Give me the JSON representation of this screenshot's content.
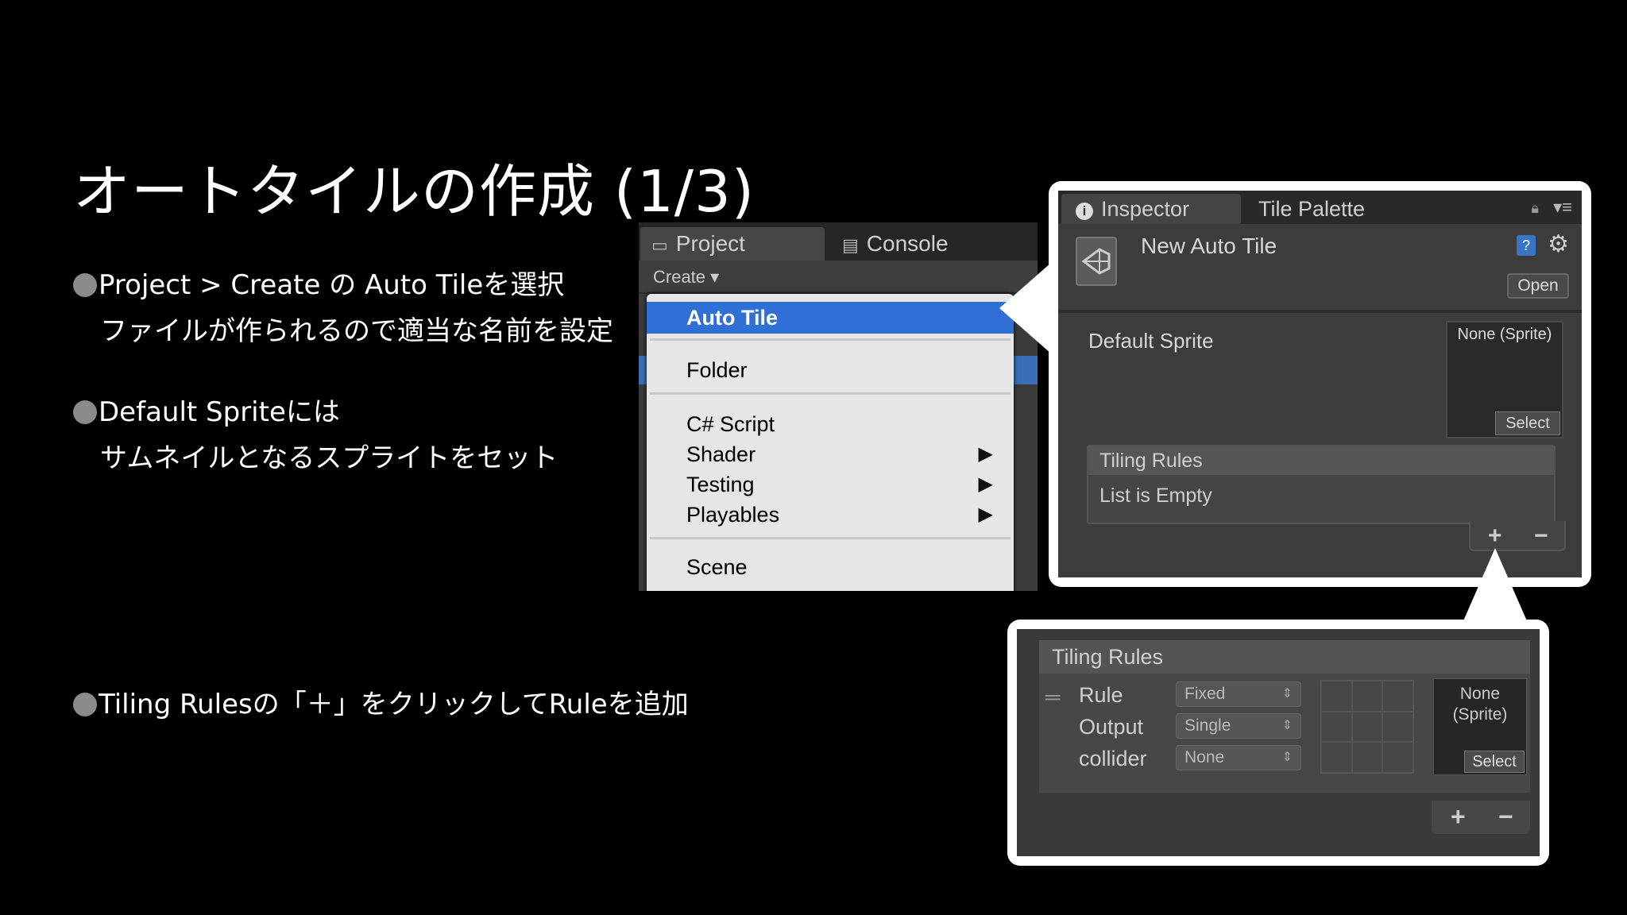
{
  "slide": {
    "title": "オートタイルの作成 (1/3)",
    "bullets": [
      {
        "line1": "Project > Create の Auto Tileを選択",
        "line2": "ファイルが作られるので適当な名前を設定"
      },
      {
        "line1": "Default Spriteには",
        "line2": "サムネイルとなるスプライトをセット"
      },
      {
        "line1": "Tiling Rulesの「＋」をクリックしてRuleを追加"
      }
    ]
  },
  "project_panel": {
    "tabs": [
      {
        "label": "Project"
      },
      {
        "label": "Console"
      }
    ],
    "create_label": "Create ▾",
    "menu_items": [
      "Auto Tile",
      "Folder",
      "C# Script",
      "Shader",
      "Testing",
      "Playables",
      "Scene"
    ],
    "submenu_arrow": "▶"
  },
  "inspector": {
    "tabs": [
      {
        "label": "Inspector"
      },
      {
        "label": "Tile Palette"
      }
    ],
    "asset_name": "New Auto Tile",
    "open_label": "Open",
    "default_sprite_label": "Default Sprite",
    "sprite_none": "None (Sprite)",
    "select_label": "Select",
    "tiling_rules_label": "Tiling Rules",
    "list_empty": "List is Empty",
    "plus": "+",
    "minus": "−"
  },
  "rules_panel": {
    "header": "Tiling Rules",
    "rule_label": "Rule",
    "output_label": "Output",
    "collider_label": "collider",
    "rule_value": "Fixed",
    "output_value": "Single",
    "collider_value": "None",
    "sprite_none_line1": "None",
    "sprite_none_line2": "(Sprite)",
    "select_label": "Select",
    "plus": "+",
    "minus": "−"
  },
  "colors": {
    "accent": "#2f6fd6",
    "panel": "#3c3c3c",
    "background": "#000000"
  }
}
